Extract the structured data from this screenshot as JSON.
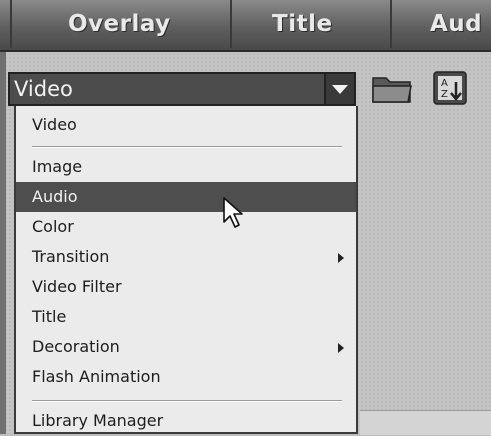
{
  "tabs": [
    {
      "label": "Overlay"
    },
    {
      "label": "Title"
    },
    {
      "label": "Aud"
    }
  ],
  "library_select": {
    "value": "Video"
  },
  "icons": {
    "folder": "folder-icon",
    "sort": "sort-az-icon",
    "dropdown_arrow": "chevron-down-icon",
    "submenu_arrow": "chevron-right-icon",
    "cursor": "mouse-pointer-icon"
  },
  "menu": {
    "items": [
      {
        "label": "Video"
      },
      {
        "label": "Image"
      },
      {
        "label": "Audio"
      },
      {
        "label": "Color"
      },
      {
        "label": "Transition"
      },
      {
        "label": "Video Filter"
      },
      {
        "label": "Title"
      },
      {
        "label": "Decoration"
      },
      {
        "label": "Flash Animation"
      },
      {
        "label": "Library Manager"
      }
    ],
    "highlighted": "Audio"
  },
  "colors": {
    "highlight": "#4e4e4e",
    "menu_bg": "#ebebeb",
    "tab_bg": "#5f5f5f"
  }
}
